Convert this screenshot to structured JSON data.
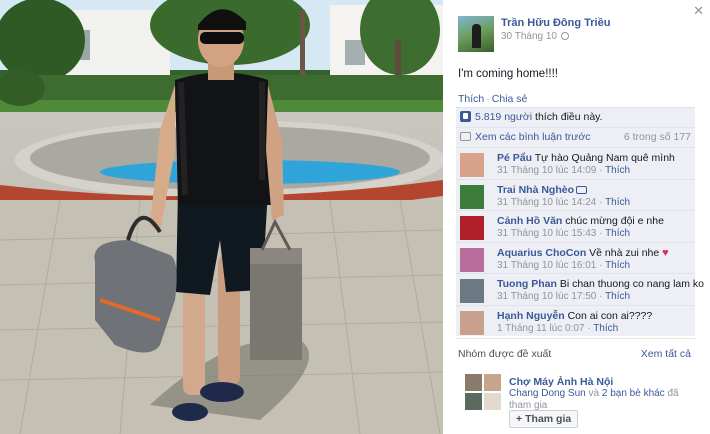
{
  "post": {
    "author": "Trần Hữu Đông Triều",
    "date": "30 Tháng 10",
    "text": "I'm coming home!!!!",
    "actions": {
      "like": "Thích",
      "share": "Chia sẻ"
    },
    "likes_text": "5.819 người thích điều này.",
    "likes_count_link": "5.819 người",
    "likes_suffix": " thích điều này.",
    "prev_comments": "Xem các bình luận trước",
    "comment_count": "6 trong số 177"
  },
  "comments": [
    {
      "name": "Pé Pẩu",
      "text": "Tự hào Quảng Nam quê mình",
      "time": "31 Tháng 10 lúc 14:09",
      "like": "Thích",
      "avatar_color": "#d8a38a"
    },
    {
      "name": "Trai Nhà Nghèo",
      "text": "",
      "time": "31 Tháng 10 lúc 14:24",
      "like": "Thích",
      "avatar_color": "#3c7d3a",
      "icon": "camera-icon"
    },
    {
      "name": "Cảnh Hồ Văn",
      "text": "chúc mừng đội e nhe",
      "time": "31 Tháng 10 lúc 15:43",
      "like": "Thích",
      "avatar_color": "#b0202a"
    },
    {
      "name": "Aquarius ChoCon",
      "text": "Về nhà zui nhe",
      "time": "31 Tháng 10 lúc 16:01",
      "like": "Thích",
      "avatar_color": "#b86d9c",
      "icon": "heart-icon"
    },
    {
      "name": "Tuong Phan",
      "text": "Bi chan thuong co nang lam ko",
      "time": "31 Tháng 10 lúc 17:50",
      "like": "Thích",
      "avatar_color": "#6c7a84"
    },
    {
      "name": "Hạnh Nguyễn",
      "text": "Con ai con ai????",
      "time": "1 Tháng 11 lúc 0:07",
      "like": "Thích",
      "avatar_color": "#c9a08e"
    }
  ],
  "groups": {
    "title": "Nhóm được đề xuất",
    "see_all": "Xem tất cả",
    "name": "Chợ Máy Ảnh Hà Nội",
    "member_link": "Chang Dong Sun",
    "members_mid": " và ",
    "friends_link": "2 bạn bè khác",
    "members_suffix": " đã tham gia",
    "join": "Tham gia"
  },
  "colors": {
    "link": "#3b5998",
    "meta": "#90949c",
    "feedback_bg": "#edeff4"
  }
}
